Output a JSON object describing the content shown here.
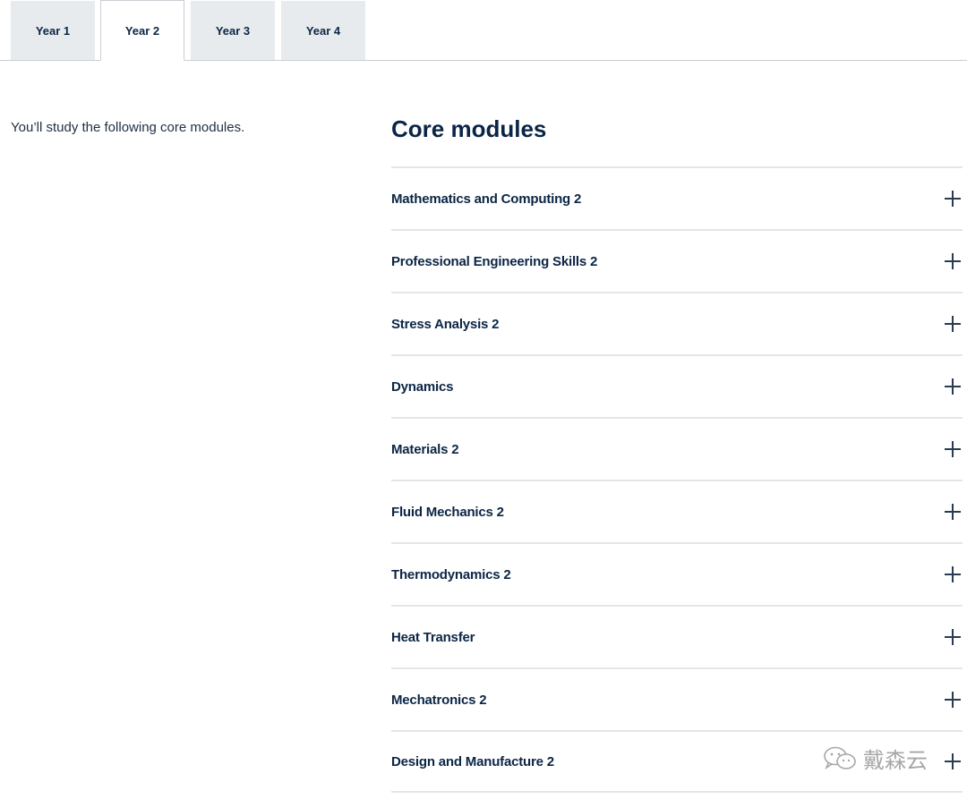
{
  "tabs": [
    {
      "label": "Year 1",
      "active": false
    },
    {
      "label": "Year 2",
      "active": true
    },
    {
      "label": "Year 3",
      "active": false
    },
    {
      "label": "Year 4",
      "active": false
    }
  ],
  "intro": "You’ll study the following core modules.",
  "core_modules": {
    "heading": "Core modules",
    "items": [
      {
        "title": "Mathematics and Computing 2",
        "icon": "plus-icon"
      },
      {
        "title": "Professional Engineering Skills 2",
        "icon": "plus-icon"
      },
      {
        "title": "Stress Analysis 2",
        "icon": "plus-icon"
      },
      {
        "title": "Dynamics",
        "icon": "plus-icon"
      },
      {
        "title": "Materials 2",
        "icon": "plus-icon"
      },
      {
        "title": "Fluid Mechanics 2",
        "icon": "plus-icon"
      },
      {
        "title": "Thermodynamics 2",
        "icon": "plus-icon"
      },
      {
        "title": "Heat Transfer",
        "icon": "plus-icon"
      },
      {
        "title": "Mechatronics 2",
        "icon": "plus-icon"
      },
      {
        "title": "Design and Manufacture 2",
        "icon": "plus-icon"
      }
    ]
  },
  "watermark": {
    "text": "戴森云",
    "icon": "wechat-icon"
  },
  "colors": {
    "text": "#0b2545",
    "tab_bg": "#e8ebee",
    "divider": "#e3e6e9"
  }
}
